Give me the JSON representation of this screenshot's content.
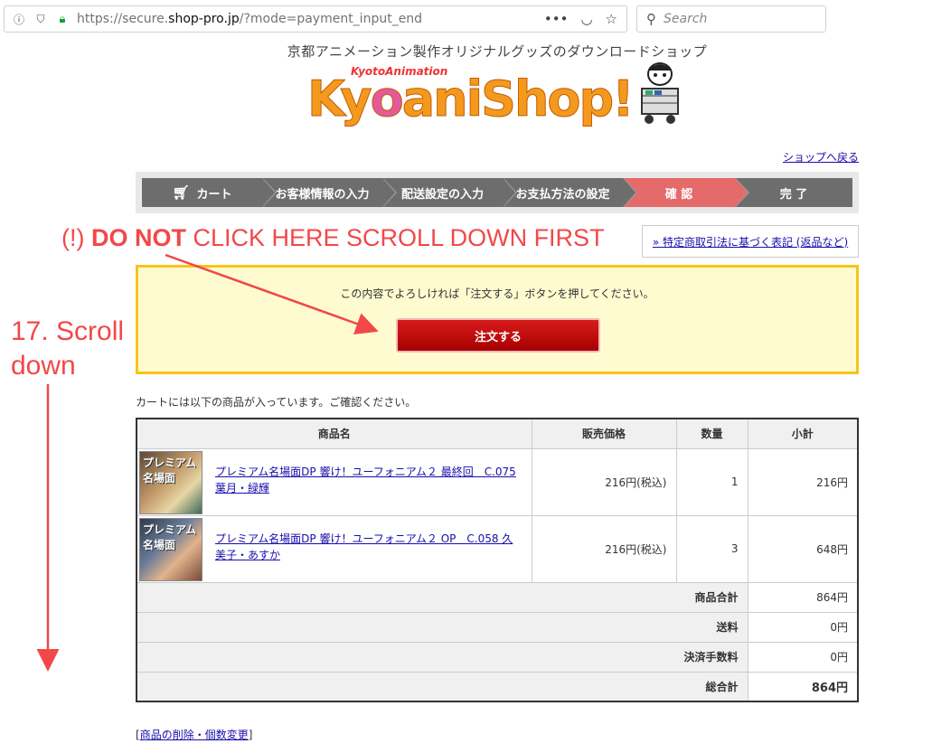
{
  "browser": {
    "url_prefix": "https://secure.",
    "url_host": "shop-pro.jp",
    "url_path": "/?mode=payment_input_end",
    "more_icon": "•••",
    "search_placeholder": "Search"
  },
  "header": {
    "tagline": "京都アニメーション製作オリジナルグッズのダウンロードショップ",
    "logo_small": "KyotoAnimation",
    "logo_main_a": "Ky",
    "logo_main_o": "o",
    "logo_main_b": "aniShop!",
    "back_link": "ショップへ戻る"
  },
  "steps": [
    {
      "label": "カート",
      "active": false
    },
    {
      "label": "お客様情報の入力",
      "active": false
    },
    {
      "label": "配送設定の入力",
      "active": false
    },
    {
      "label": "お支払方法の設定",
      "active": false
    },
    {
      "label": "確 認",
      "active": true
    },
    {
      "label": "完 了",
      "active": false
    }
  ],
  "notice_link": "» 特定商取引法に基づく表記 (返品など)",
  "annotations": {
    "top_prefix": "(!) ",
    "top_bold": "DO NOT",
    "top_suffix": " CLICK HERE SCROLL DOWN FIRST",
    "side": "17. Scroll\ndown"
  },
  "confirm": {
    "message": "この内容でよろしければ「注文する」ボタンを押してください。",
    "button": "注文する"
  },
  "cart_intro": "カートには以下の商品が入っています。ご確認ください。",
  "table": {
    "headers": [
      "商品名",
      "販売価格",
      "数量",
      "小計"
    ],
    "rows": [
      {
        "thumb": "プレミアム名場面",
        "name": "プレミアム名場面DP 響け！ユーフォニアム２ 最終回　C.075 葉月・緑輝",
        "price": "216円(税込)",
        "qty": "1",
        "subtotal": "216円"
      },
      {
        "thumb": "プレミアム名場面",
        "name": "プレミアム名場面DP 響け！ユーフォニアム２ OP　C.058 久美子・あすか",
        "price": "216円(税込)",
        "qty": "3",
        "subtotal": "648円"
      }
    ],
    "summary": [
      {
        "label": "商品合計",
        "value": "864円"
      },
      {
        "label": "送料",
        "value": "0円"
      },
      {
        "label": "決済手数料",
        "value": "0円"
      },
      {
        "label": "総合計",
        "value": "864円"
      }
    ]
  },
  "edit_link": "商品の削除・個数変更",
  "colors": {
    "accent_red": "#d71b1b",
    "annotation": "#f24848",
    "active_step": "#e56a6a",
    "confirm_bg": "#fffbd0",
    "confirm_border": "#f7c418"
  }
}
